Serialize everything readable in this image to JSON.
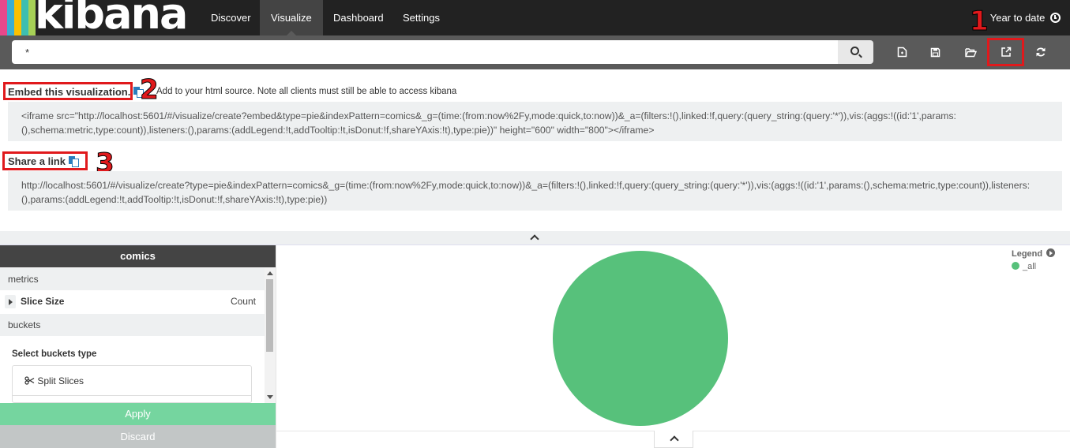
{
  "nav": {
    "logo_text": "kibana",
    "logo_colors": [
      "#e8488b",
      "#3caed2",
      "#fcc000",
      "#3ebeb0",
      "#a6d056"
    ],
    "tabs": [
      {
        "label": "Discover",
        "active": false
      },
      {
        "label": "Visualize",
        "active": true
      },
      {
        "label": "Dashboard",
        "active": false
      },
      {
        "label": "Settings",
        "active": false
      }
    ],
    "time_label": "Year to date",
    "time_icon": "clock-icon"
  },
  "search": {
    "query": "*",
    "search_icon": "search-icon"
  },
  "toolbar": {
    "buttons": [
      "new-visualization-icon",
      "save-icon",
      "open-icon",
      "share-icon",
      "refresh-icon"
    ]
  },
  "annotations": {
    "step1": "1",
    "step2": "2",
    "step3": "3",
    "highlight_color": "#e0191c"
  },
  "share": {
    "embed_title": "Embed this visualization.",
    "embed_note": "Add to your html source. Note all clients must still be able to access kibana",
    "embed_code": "<iframe src=\"http://localhost:5601/#/visualize/create?embed&type=pie&indexPattern=comics&_g=(time:(from:now%2Fy,mode:quick,to:now))&_a=(filters:!(),linked:!f,query:(query_string:(query:'*')),vis:(aggs:!((id:'1',params:(),schema:metric,type:count)),listeners:(),params:(addLegend:!t,addTooltip:!t,isDonut:!f,shareYAxis:!t),type:pie))\" height=\"600\" width=\"800\"></iframe>",
    "link_title": "Share a link",
    "link_url": "http://localhost:5601/#/visualize/create?type=pie&indexPattern=comics&_g=(time:(from:now%2Fy,mode:quick,to:now))&_a=(filters:!(),linked:!f,query:(query_string:(query:'*')),vis:(aggs:!((id:'1',params:(),schema:metric,type:count)),listeners:(),params:(addLegend:!t,addTooltip:!t,isDonut:!f,shareYAxis:!t),type:pie))"
  },
  "sidebar": {
    "index_pattern": "comics",
    "metrics_label": "metrics",
    "slice_size_label": "Slice Size",
    "slice_size_value": "Count",
    "buckets_label": "buckets",
    "select_buckets_label": "Select buckets type",
    "split_slices_label": "Split Slices",
    "apply_label": "Apply",
    "discard_label": "Discard"
  },
  "chart": {
    "legend_title": "Legend",
    "legend_items": [
      {
        "label": "_all",
        "color": "#57c17b"
      }
    ],
    "pie_color": "#57c17b"
  },
  "chart_data": {
    "type": "pie",
    "categories": [
      "_all"
    ],
    "values": [
      1
    ]
  }
}
